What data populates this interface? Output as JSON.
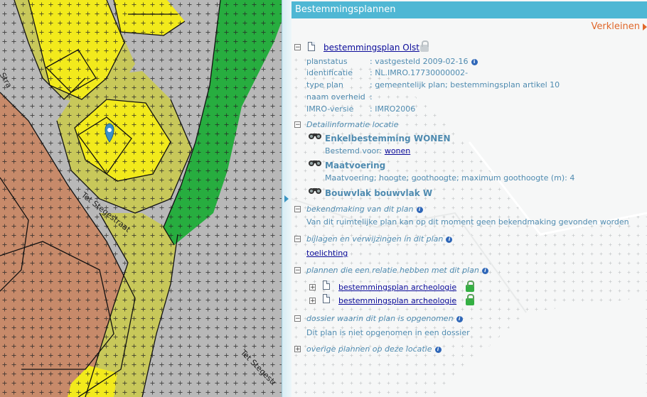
{
  "map": {
    "street_labels": [
      "Tet Stegestraat",
      "Tet Stegestr",
      "Stra"
    ]
  },
  "panel": {
    "title": "Bestemmingsplannen",
    "collapse_label": "Verkleinen",
    "plan": {
      "toggle": "−",
      "name": "bestemmingsplan Olst",
      "fields": [
        {
          "label": "planstatus",
          "value": ": vastgesteld 2009-02-16"
        },
        {
          "label": "identificatie",
          "value": ": NL.IMRO.17730000002-"
        },
        {
          "label": "type plan",
          "value": ": gemeentelijk plan; bestemmingsplan artikel 10"
        },
        {
          "label": "naam overheid",
          "value": ":"
        },
        {
          "label": "IMRO-versie",
          "value": ": IMRO2006"
        }
      ]
    },
    "detail": {
      "toggle": "−",
      "title": "Detailinformatie locatie",
      "items": [
        {
          "title": "Enkelbestemming WONEN",
          "desc_prefix": "Bestemd voor: ",
          "desc_link": "wonen"
        },
        {
          "title": "Maatvoering",
          "desc": "Maatvoering; hoogte; goothoogte; maximum goothoogte (m): 4"
        },
        {
          "title": "Bouwvlak bouwvlak W"
        }
      ]
    },
    "bekendmaking": {
      "toggle": "−",
      "title": "bekendmaking van dit plan",
      "text": "Van dit ruimtelijke plan kan op dit moment geen bekendmaking gevonden worden"
    },
    "bijlagen": {
      "toggle": "−",
      "title": "bijlagen en verwijzingen in dit plan",
      "link": "toelichting"
    },
    "relaties": {
      "toggle": "−",
      "title": "plannen die een relatie hebben met dit plan",
      "items": [
        {
          "toggle": "+",
          "name": "bestemmingsplan archeologie"
        },
        {
          "toggle": "+",
          "name": "bestemmingsplan archeologie"
        }
      ]
    },
    "dossier": {
      "toggle": "−",
      "title": "dossier waarin dit plan is opgenomen",
      "text": "Dit plan is niet opgenomen in een dossier"
    },
    "overige": {
      "toggle": "+",
      "title": "overige plannen op deze locatie"
    },
    "info_glyph": "i"
  },
  "colors": {
    "titlebar": "#4fb7d4",
    "collapse": "#e0672a",
    "wonen_yellow": "#f2ea1c",
    "tuin_olive": "#c8c85a",
    "groen": "#27ad3f",
    "bedrijf_brown": "#c78a6a",
    "verkeer_grey": "#b8b8b8"
  }
}
